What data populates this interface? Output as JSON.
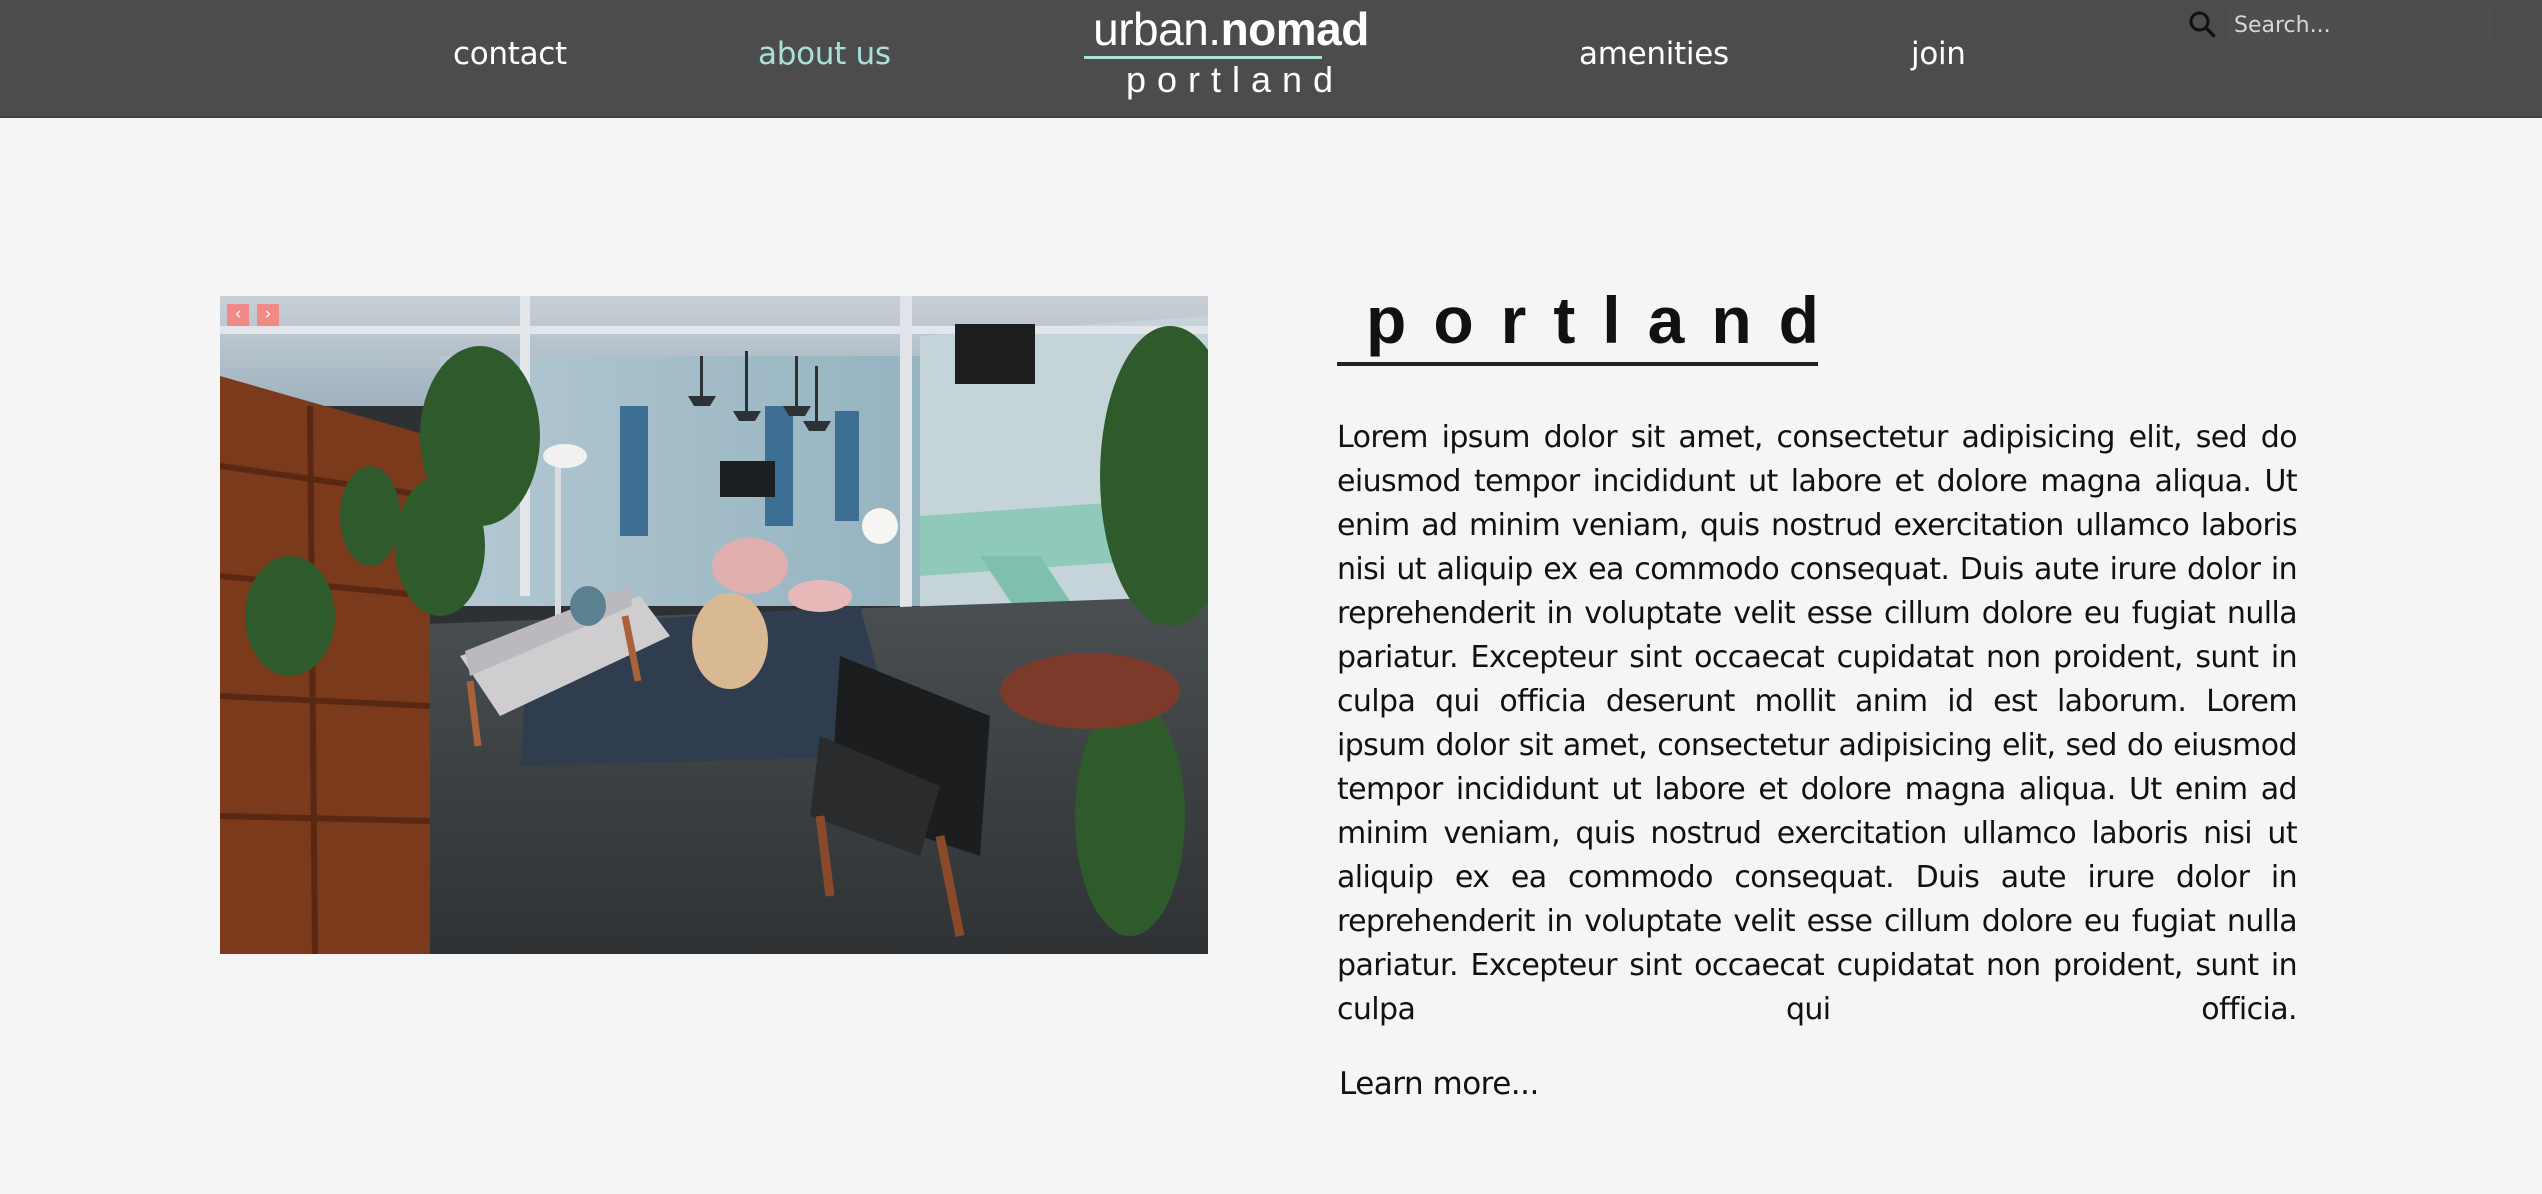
{
  "nav": {
    "contact": "contact",
    "about": "about us",
    "amenities": "amenities",
    "join": "join"
  },
  "logo": {
    "prefix": "urban.",
    "name": "nomad",
    "city": "portland"
  },
  "search": {
    "placeholder": "Search...",
    "icon": "search-icon"
  },
  "slideshow": {
    "prev_label": "‹",
    "next_label": "›",
    "photo": "coworking lounge interior with sofa, plants and shelves"
  },
  "content": {
    "title": "portland",
    "body": "Lorem ipsum dolor sit amet, consectetur adipisicing elit, sed do eiusmod tempor incididunt ut labore et dolore magna aliqua. Ut enim ad minim veniam, quis nostrud exercitation ullamco laboris nisi ut aliquip ex ea commodo consequat. Duis aute irure dolor in reprehenderit in voluptate velit esse cillum dolore eu fugiat nulla pariatur. Excepteur sint occaecat cupidatat non proident, sunt in culpa qui officia deserunt mollit anim id est laborum. Lorem ipsum dolor sit amet, consectetur adipisicing elit, sed do eiusmod tempor incididunt ut labore et dolore magna aliqua. Ut enim ad minim veniam, quis nostrud exercitation ullamco laboris nisi ut aliquip ex ea commodo consequat. Duis aute irure dolor in reprehenderit in voluptate velit esse cillum dolore eu fugiat nulla pariatur. Excepteur sint occaecat cupidatat non proident, sunt in culpa qui officia.",
    "learn_more": "Learn more..."
  },
  "colors": {
    "header_bg": "#4c4c4c",
    "accent": "#a9e0d8",
    "arrow": "#f08a86",
    "page_bg": "#f5f5f5"
  }
}
